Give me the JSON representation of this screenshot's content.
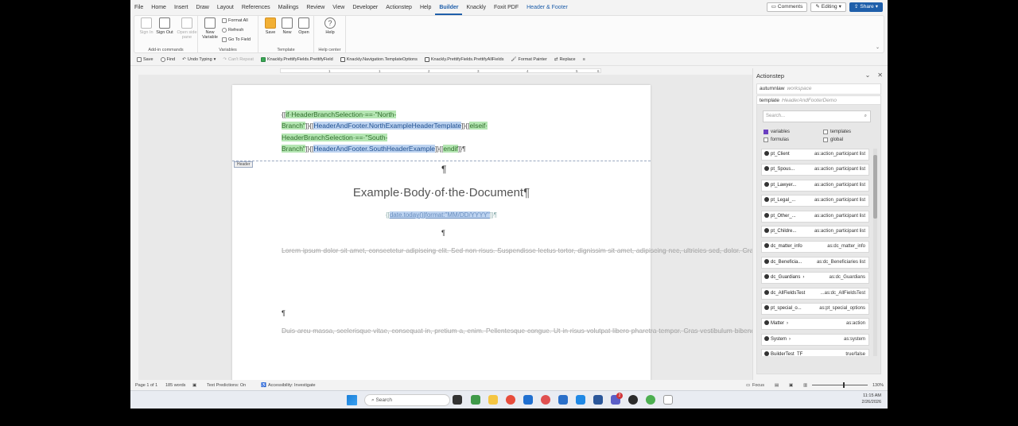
{
  "menubar": {
    "items": [
      "File",
      "Home",
      "Insert",
      "Draw",
      "Layout",
      "References",
      "Mailings",
      "Review",
      "View",
      "Developer",
      "Actionstep",
      "Help",
      "Builder",
      "Knackly",
      "Foxit PDF",
      "Header & Footer"
    ],
    "active": "Builder",
    "comments": "Comments",
    "editing": "Editing",
    "share": "Share"
  },
  "ribbon": {
    "addin": {
      "sign_in": "Sign In",
      "sign_out": "Sign Out",
      "open_side_pane": "Open side pane",
      "label": "Add-in commands"
    },
    "variables": {
      "new_variable": "New Variable",
      "format_all": "Format All",
      "refresh": "Refresh",
      "go_to_field": "Go To Field",
      "label": "Variables"
    },
    "template": {
      "save": "Save",
      "new": "New",
      "open": "Open",
      "label": "Template"
    },
    "help": {
      "help": "Help",
      "label": "Help center"
    }
  },
  "qat": {
    "save": "Save",
    "find": "Find",
    "undo": "Undo Typing",
    "repeat": "Can't Repeat",
    "prettify_field": "Knackly.PrettifyFields.PrettifyField",
    "template_options": "Knackly.Navigation.TemplateOptions",
    "prettify_all": "Knackly.PrettifyFields.PrettifyAllFields",
    "format_painter": "Format Painter",
    "replace": "Replace"
  },
  "ruler": {
    "ticks": [
      "1",
      "1",
      "2",
      "3",
      "4",
      "5",
      "6"
    ]
  },
  "document": {
    "header": {
      "l1_a": "{[",
      "l1_b": "if·HeaderBranchSelection·==·\"North-",
      "l2_a": "Branch\"",
      "l2_b": "]}{[",
      "l2_c": "HeaderAndFooter.NorthExampleHeaderTemplate",
      "l2_d": "]}{[",
      "l2_e": "elseif·",
      "l3_a": "HeaderBranchSelection·==·\"South-",
      "l4_a": "Branch\"",
      "l4_b": "]}{[",
      "l4_c": "HeaderAndFooter.SouthHeaderExample",
      "l4_d": "]}{[",
      "l4_e": "endif",
      "l4_f": "]}¶",
      "tag": "Header"
    },
    "pilcrow": "¶",
    "title": "Example·Body·of·the·Document¶",
    "date_open": "{[",
    "date_field": "date.today()|format:\"MM/DD/YYYY\"",
    "date_close": "]}¶",
    "para1": "Lorem·ipsum·dolor·sit·amet,·consectetur·adipiscing·elit.·Sed·non·risus.·Suspendisse·lectus·tortor,·dignissim·sit·amet,·adipiscing·nec,·ultricies·sed,·dolor.·Cras·elementum·ultrices·diam.·Maecenas·ligula·massa,·varius·a,·semper·congue,·euismod·non,·mi.·Proin·porttitor,·orci·nec·nonummy·molestie,·enim·est·eleifend·mi,·non·fermentum·diam·nisl·sit·amet·erat.·Duis·semper.¶",
    "para2": "Duis·arcu·massa,·scelerisque·vitae,·consequat·in,·pretium·a,·enim.·Pellentesque·congue.·Ut·in·risus·volutpat·libero·pharetra·tempor.·Cras·vestibulum·bibendum·augue.·Praesent·egestas·leo·in·pede.·Praesent·blandit·odio·eu·enim.·Pellentesque·sed·dui·ut·augue·blandit·sodales.·Vestibulum·ante·ipsum·primis·in·faucibus·orci·luctus·et·ultrices·posuere·cubilia·Curae;·Aliquam·nibh.·Mauris·ac·mauris·sed·pede·pellentesque·fermentum.¶"
  },
  "panel": {
    "title": "Actionstep",
    "workspace_value": "autumnlaw",
    "workspace_hint": "workspace",
    "template_label": "template",
    "template_value": "HeaderAndFooterDemo",
    "search_placeholder": "Search...",
    "filters": {
      "variables": "variables",
      "templates": "templates",
      "formulas": "formulas",
      "global": "global"
    },
    "items": [
      {
        "name": "pt_Client",
        "value": "as:action_participant list",
        "chev": ""
      },
      {
        "name": "pt_Spous...",
        "value": "as:action_participant list",
        "chev": ""
      },
      {
        "name": "pt_Lawyer...",
        "value": "as:action_participant list",
        "chev": ""
      },
      {
        "name": "pt_Legal_...",
        "value": "as:action_participant list",
        "chev": ""
      },
      {
        "name": "pt_Other_...",
        "value": "as:action_participant list",
        "chev": ""
      },
      {
        "name": "pt_Childre...",
        "value": "as:action_participant list",
        "chev": ""
      },
      {
        "name": "dc_matter_info",
        "value": "as:dc_matter_info",
        "chev": ""
      },
      {
        "name": "dc_Beneficia...",
        "value": "as:dc_Beneficiaries list",
        "chev": ""
      },
      {
        "name": "dc_Guardians",
        "value": "as:dc_Guardians",
        "chev": "›"
      },
      {
        "name": "dc_AllFieldsTest",
        "value": "...as:dc_AllFieldsTest",
        "chev": ""
      },
      {
        "name": "pt_special_o...",
        "value": "as:pt_special_options",
        "chev": ""
      },
      {
        "name": "Matter",
        "value": "as:action",
        "chev": "›"
      },
      {
        "name": "System",
        "value": "as:system",
        "chev": "›"
      },
      {
        "name": "BuilderTest_TF",
        "value": "true/false",
        "chev": ""
      }
    ]
  },
  "status": {
    "page": "Page 1 of 1",
    "words": "185 words",
    "predictions": "Text Predictions: On",
    "accessibility": "Accessibility: Investigate",
    "focus": "Focus",
    "zoom": "130%"
  },
  "taskbar": {
    "search": "Search",
    "time": "11:15 AM",
    "date": "2/26/2026",
    "badge": "2"
  }
}
